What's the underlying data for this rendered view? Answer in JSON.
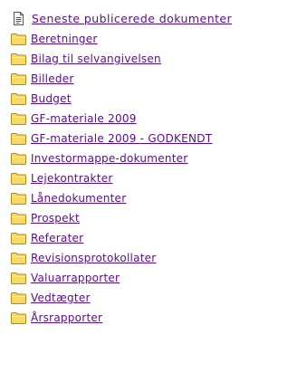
{
  "top_item": {
    "label": "Seneste publicerede dokumenter",
    "icon": "document-icon"
  },
  "folder_icon": "folder-icon",
  "colors": {
    "link": "#5a0d8c",
    "folder_fill": "#f7d968",
    "folder_stroke": "#b58b13"
  },
  "folders": [
    {
      "label": "Beretninger"
    },
    {
      "label": "Bilag til selvangivelsen"
    },
    {
      "label": "Billeder"
    },
    {
      "label": "Budget"
    },
    {
      "label": "GF-materiale 2009"
    },
    {
      "label": "GF-materiale 2009 - GODKENDT"
    },
    {
      "label": "Investormappe-dokumenter"
    },
    {
      "label": "Lejekontrakter"
    },
    {
      "label": "Lånedokumenter"
    },
    {
      "label": "Prospekt"
    },
    {
      "label": "Referater"
    },
    {
      "label": "Revisionsprotokollater"
    },
    {
      "label": "Valuarrapporter"
    },
    {
      "label": "Vedtægter"
    },
    {
      "label": "Årsrapporter"
    }
  ]
}
